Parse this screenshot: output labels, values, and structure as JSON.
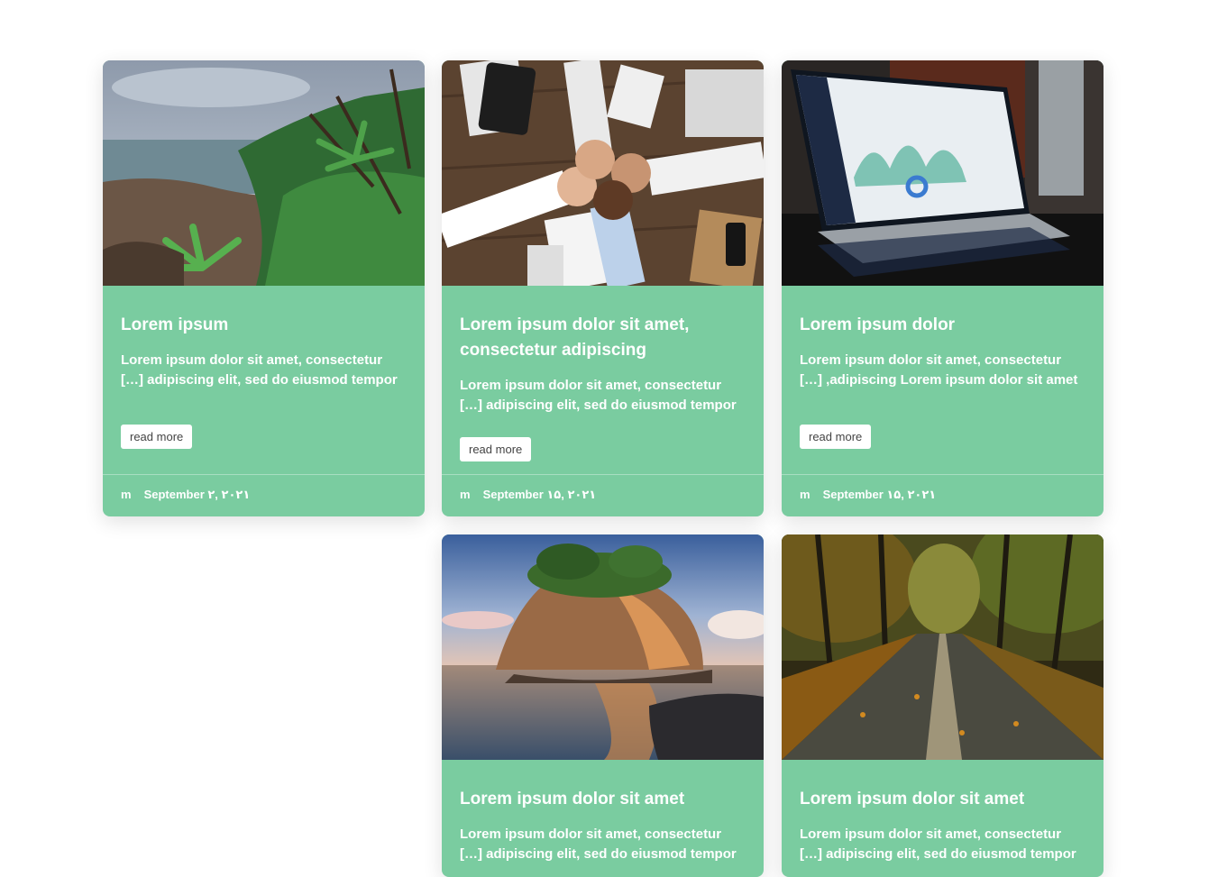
{
  "cards": [
    {
      "title": "Lorem ipsum",
      "excerpt": "Lorem ipsum dolor sit amet, consectetur […] adipiscing elit, sed do eiusmod tempor",
      "read_more": "read more",
      "author": "m",
      "date": "September ۲, ۲۰۲۱",
      "image": "coast-with-palm-trees"
    },
    {
      "title": "Lorem ipsum dolor sit amet, consectetur adipiscing",
      "excerpt": "Lorem ipsum dolor sit amet, consectetur […] adipiscing elit, sed do eiusmod tempor",
      "read_more": "read more",
      "author": "m",
      "date": "September ۱۵, ۲۰۲۱",
      "image": "team-fists-on-desk"
    },
    {
      "title": "Lorem ipsum dolor",
      "excerpt": "Lorem ipsum dolor sit amet, consectetur […] ,adipiscing Lorem ipsum dolor sit amet",
      "read_more": "read more",
      "author": "m",
      "date": "September ۱۵, ۲۰۲۱",
      "image": "laptop-with-dashboard"
    },
    {
      "title": "Lorem ipsum dolor sit amet",
      "excerpt": "Lorem ipsum dolor sit amet, consectetur […] adipiscing elit, sed do eiusmod tempor",
      "image": "rock-island-sunset"
    },
    {
      "title": "Lorem ipsum dolor sit amet",
      "excerpt": "Lorem ipsum dolor sit amet, consectetur […] adipiscing elit, sed do eiusmod tempor",
      "image": "autumn-road"
    }
  ],
  "colors": {
    "card_bg": "#7acca0",
    "page_bg": "#ffffff",
    "button_bg": "#ffffff"
  }
}
